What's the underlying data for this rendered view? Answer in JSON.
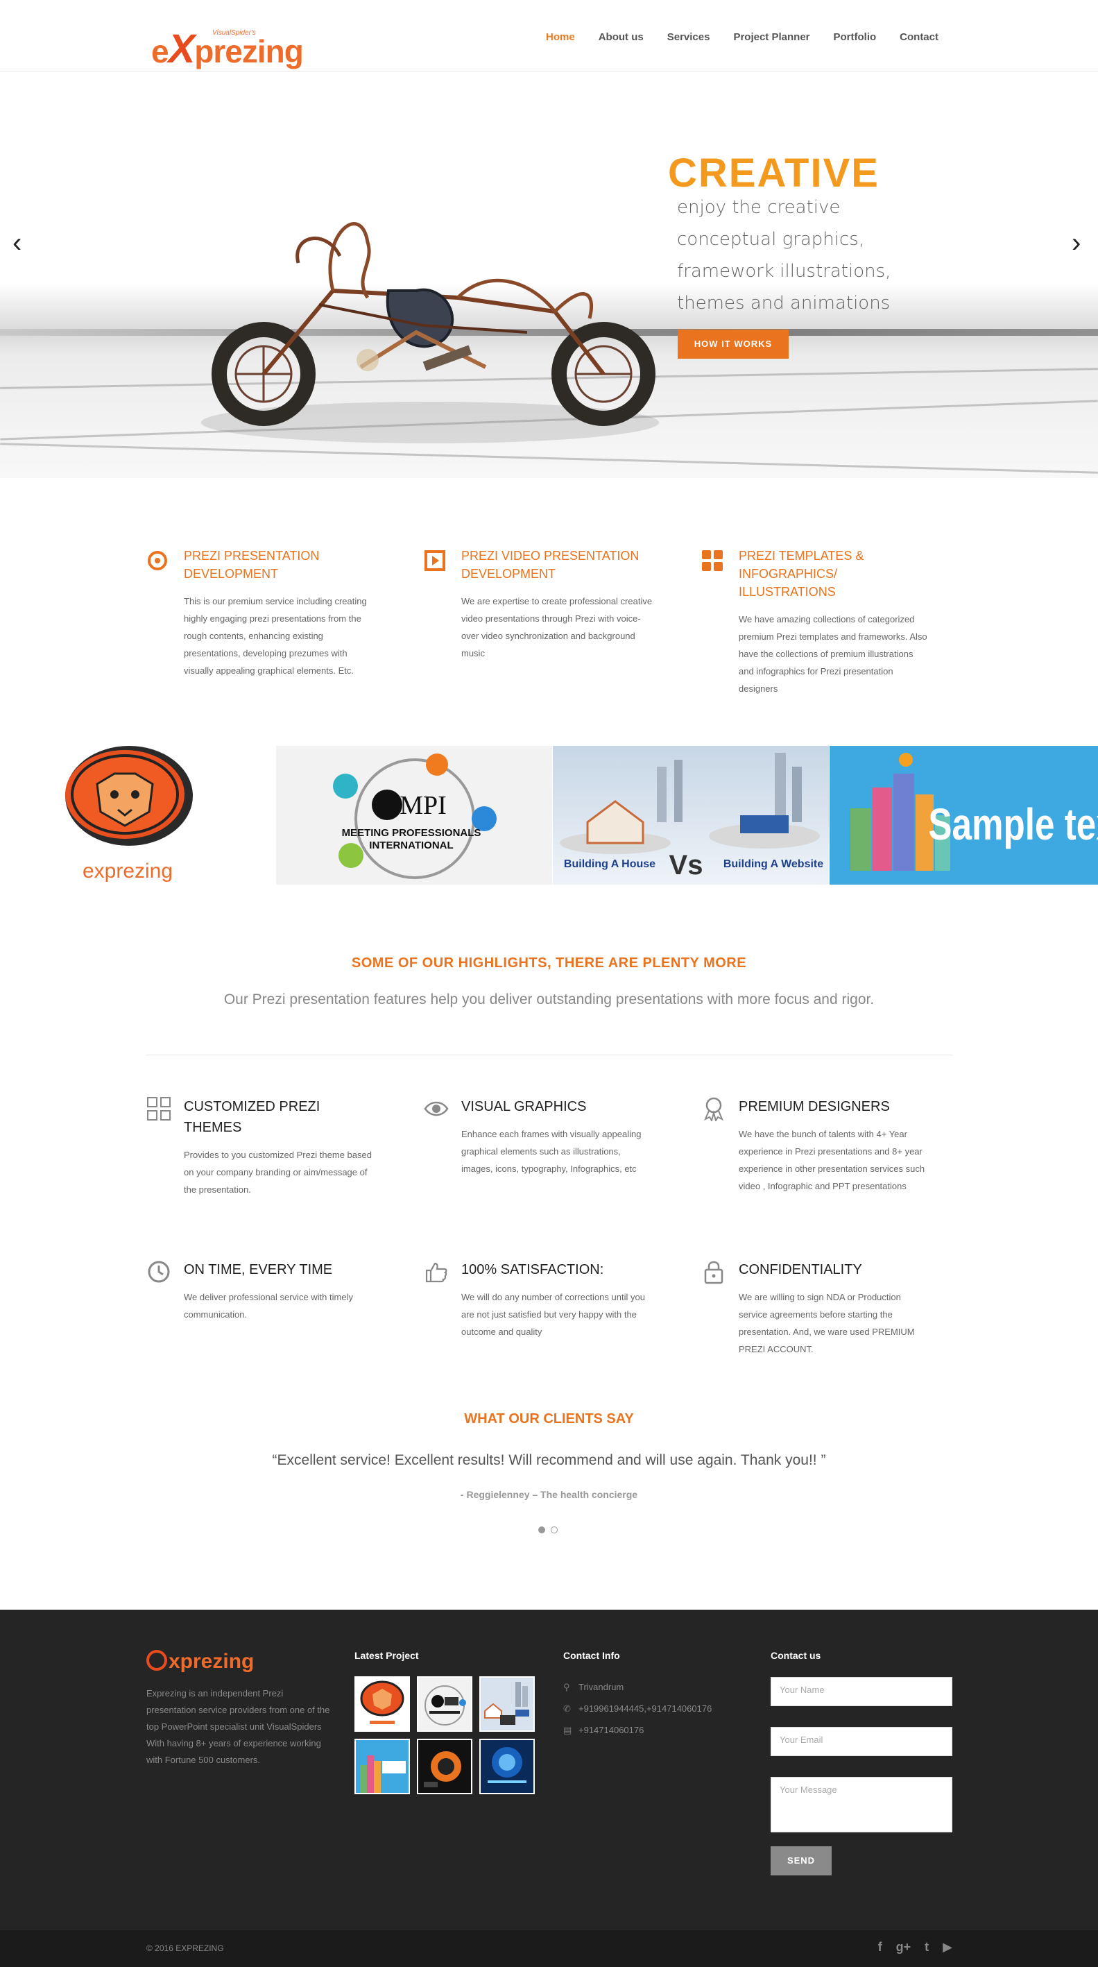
{
  "header": {
    "logo_tag": "VisualSpider's",
    "logo_text_pre": "e",
    "logo_text_x": "X",
    "logo_text_post": "prezing",
    "nav": [
      "Home",
      "About us",
      "Services",
      "Project Planner",
      "Portfolio",
      "Contact"
    ],
    "active_nav": "Home"
  },
  "hero": {
    "title": "CREATIVE",
    "text": "enjoy the creative conceptual graphics, framework illustrations, themes and animations",
    "button": "HOW IT WORKS",
    "arrow_left": "‹",
    "arrow_right": "›"
  },
  "services": [
    {
      "icon": "target-icon",
      "title": "PREZI PRESENTATION DEVELOPMENT",
      "text": "This is our premium service including creating highly engaging prezi presentations from the rough contents, enhancing existing presentations, developing prezumes with visually appealing graphical elements. Etc."
    },
    {
      "icon": "play-icon",
      "title": "PREZI VIDEO PRESENTATION DEVELOPMENT",
      "text": "We are expertise to create professional creative video presentations through Prezi with voice-over video synchronization and background music"
    },
    {
      "icon": "grid-icon",
      "title": "PREZI TEMPLATES & INFOGRAPHICS/ ILLUSTRATIONS",
      "text": "We have amazing collections of categorized premium Prezi templates and frameworks. Also have the collections of premium illustrations and infographics for Prezi presentation designers"
    }
  ],
  "gallery": {
    "mpi_line1": "MEETING PROFESSIONALS",
    "mpi_line2": "INTERNATIONAL",
    "mpi_logo": "MPI",
    "house_label": "Building A House",
    "vs": "Vs",
    "website_label": "Building A Website",
    "sample_text": "Sample tex",
    "tiger_brand": "exprezing"
  },
  "highlights": {
    "title": "SOME OF OUR HIGHLIGHTS, THERE ARE PLENTY MORE",
    "subtitle": "Our Prezi presentation features help you deliver outstanding presentations with more focus and rigor.",
    "features": [
      {
        "icon": "squares-icon",
        "title": "CUSTOMIZED PREZI THEMES",
        "text": "Provides to you customized Prezi theme based on your company branding or aim/message of the presentation."
      },
      {
        "icon": "eye-icon",
        "title": "VISUAL GRAPHICS",
        "text": "Enhance each frames with visually appealing graphical elements such as illustrations, images, icons, typography, Infographics, etc"
      },
      {
        "icon": "award-icon",
        "title": "PREMIUM DESIGNERS",
        "text": "We have the bunch of talents with 4+ Year experience in Prezi presentations and 8+ year experience in other presentation services such video , Infographic and PPT presentations"
      },
      {
        "icon": "clock-icon",
        "title": "ON TIME, EVERY TIME",
        "text": "We deliver professional service with timely communication."
      },
      {
        "icon": "thumbs-up-icon",
        "title": "100% SATISFACTION:",
        "text": "We will do any number of corrections until you are not just satisfied but very happy with the outcome and quality"
      },
      {
        "icon": "lock-icon",
        "title": "CONFIDENTIALITY",
        "text": "We are willing to sign NDA or Production service agreements before starting the presentation. And, we ware used PREMIUM PREZI ACCOUNT."
      }
    ]
  },
  "testimonial": {
    "title": "WHAT OUR CLIENTS SAY",
    "quote": "“Excellent service! Excellent results! Will recommend and will use again. Thank you!! ”",
    "author": "- Reggielenney – The health concierge",
    "active_dot": 0
  },
  "footer": {
    "logo": "xprezing",
    "about": "Exprezing is an independent Prezi presentation service providers from one of the top PowerPoint specialist unit VisualSpiders With having 8+ years of experience working with Fortune 500 customers.",
    "latest_title": "Latest Project",
    "contact_info_title": "Contact Info",
    "address": "Trivandrum",
    "phone": "+919961944445,+914714060176",
    "fax": "+914714060176",
    "contact_title": "Contact us",
    "name_placeholder": "Your Name",
    "email_placeholder": "Your Email",
    "message_placeholder": "Your Message",
    "send": "SEND",
    "copyright": "© 2016 EXPREZING",
    "social": [
      "f",
      "g+",
      "t",
      "▶"
    ]
  }
}
